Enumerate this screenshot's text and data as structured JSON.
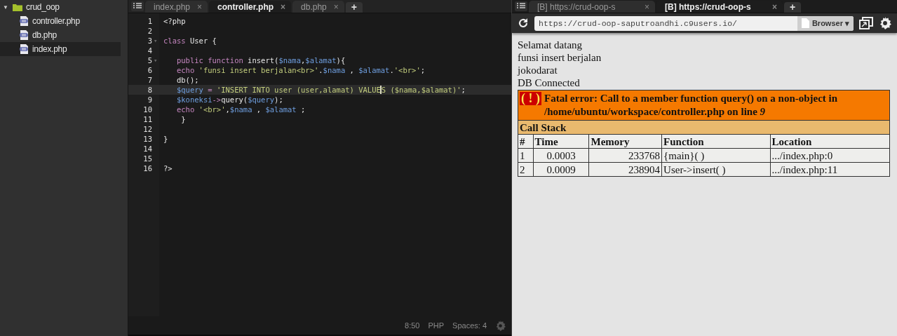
{
  "sidebar": {
    "tree": [
      {
        "label": "crud_oop",
        "kind": "folder",
        "toggle": "▼",
        "expanded": true,
        "selected": false,
        "children": [
          {
            "label": "controller.php",
            "kind": "php",
            "selected": false
          },
          {
            "label": "db.php",
            "kind": "php",
            "selected": false
          },
          {
            "label": "index.php",
            "kind": "php",
            "selected": true
          }
        ]
      }
    ]
  },
  "editor": {
    "tabs": [
      {
        "label": "index.php",
        "close": "×",
        "selected": false
      },
      {
        "label": "controller.php",
        "close": "×",
        "selected": true
      },
      {
        "label": "db.php",
        "close": "×",
        "selected": false
      }
    ],
    "add_tab": "+",
    "lines": [
      {
        "number": "1",
        "active": false,
        "tokens": [
          {
            "text": "<?php",
            "kind": "plain"
          }
        ]
      },
      {
        "number": "2",
        "active": false
      },
      {
        "number": "3",
        "fold_marker": "▾",
        "active": false,
        "tokens": [
          {
            "text": "class",
            "kind": "keyword"
          },
          {
            "text": " User {",
            "kind": "plain"
          }
        ]
      },
      {
        "number": "4",
        "active": false
      },
      {
        "number": "5",
        "fold_marker": "▾",
        "active": false,
        "tokens": [
          {
            "text": "   public function",
            "kind": "keyword"
          },
          {
            "text": " insert(",
            "kind": "plain"
          },
          {
            "text": "$nama",
            "kind": "var"
          },
          {
            "text": ",",
            "kind": "plain"
          },
          {
            "text": "$alamat",
            "kind": "var"
          },
          {
            "text": "){",
            "kind": "plain"
          }
        ]
      },
      {
        "number": "6",
        "active": false,
        "tokens": [
          {
            "text": "   echo",
            "kind": "keyword"
          },
          {
            "text": " 'funsi insert berjalan<br>'",
            "kind": "string"
          },
          {
            "text": ".",
            "kind": "plain"
          },
          {
            "text": "$nama",
            "kind": "var"
          },
          {
            "text": " , ",
            "kind": "plain"
          },
          {
            "text": "$alamat",
            "kind": "var"
          },
          {
            "text": ".",
            "kind": "plain"
          },
          {
            "text": "'<br>'",
            "kind": "string"
          },
          {
            "text": ";",
            "kind": "plain"
          }
        ]
      },
      {
        "number": "7",
        "active": false,
        "tokens": [
          {
            "text": "   db();",
            "kind": "plain"
          }
        ]
      },
      {
        "number": "8",
        "active": true,
        "tokens": [
          {
            "text": "   $query",
            "kind": "var"
          },
          {
            "text": " = ",
            "kind": "keyword"
          },
          {
            "text": "'INSERT INTO user (user,alamat) VALUE",
            "kind": "string"
          },
          {
            "text": "S ($nama,$alamat)'",
            "kind": "string",
            "cursor": true
          },
          {
            "text": ";",
            "kind": "plain"
          }
        ]
      },
      {
        "number": "9",
        "active": false,
        "tokens": [
          {
            "text": "   $koneksi",
            "kind": "var"
          },
          {
            "text": "->",
            "kind": "keyword"
          },
          {
            "text": "query(",
            "kind": "plain"
          },
          {
            "text": "$query",
            "kind": "var"
          },
          {
            "text": ");",
            "kind": "plain"
          }
        ]
      },
      {
        "number": "10",
        "active": false,
        "tokens": [
          {
            "text": "   echo",
            "kind": "keyword"
          },
          {
            "text": " '<br>'",
            "kind": "string"
          },
          {
            "text": ",",
            "kind": "plain"
          },
          {
            "text": "$nama",
            "kind": "var"
          },
          {
            "text": " , ",
            "kind": "plain"
          },
          {
            "text": "$alamat",
            "kind": "var"
          },
          {
            "text": " ;",
            "kind": "plain"
          }
        ]
      },
      {
        "number": "11",
        "active": false,
        "tokens": [
          {
            "text": "    }",
            "kind": "plain"
          }
        ]
      },
      {
        "number": "12",
        "active": false
      },
      {
        "number": "13",
        "active": false,
        "tokens": [
          {
            "text": "}",
            "kind": "plain"
          }
        ]
      },
      {
        "number": "14",
        "active": false
      },
      {
        "number": "15",
        "active": false
      },
      {
        "number": "16",
        "active": false,
        "tokens": [
          {
            "text": "?>",
            "kind": "plain"
          }
        ]
      }
    ],
    "status_bar": {
      "position": "8:50",
      "language": "PHP",
      "indent": "Spaces: 4"
    }
  },
  "browser": {
    "tabs": [
      {
        "label": "[B] https://crud-oop-s",
        "close": "×",
        "selected": false
      },
      {
        "label": "[B] https://crud-oop-s",
        "close": "×",
        "selected": true
      }
    ],
    "add_tab": "+",
    "address": "https://crud-oop-saputroandhi.c9users.io/",
    "mode_button": "Browser",
    "mode_caret": "▾",
    "output_lines": [
      "Selamat datang",
      "funsi insert berjalan",
      "jokodarat",
      "DB Connected"
    ],
    "error": {
      "icon_text": "( ! )",
      "message": "Fatal error: Call to a member function query() on a non-object in /home/ubuntu/workspace/controller.php on line *9*",
      "call_stack_title": "Call Stack",
      "columns": [
        "#",
        "Time",
        "Memory",
        "Function",
        "Location"
      ],
      "rows": [
        [
          "1",
          "0.0003",
          "233768",
          "{main}( )",
          ".../index.php:0"
        ],
        [
          "2",
          "0.0009",
          "238904",
          "User->insert( )",
          ".../index.php:11"
        ]
      ]
    }
  }
}
